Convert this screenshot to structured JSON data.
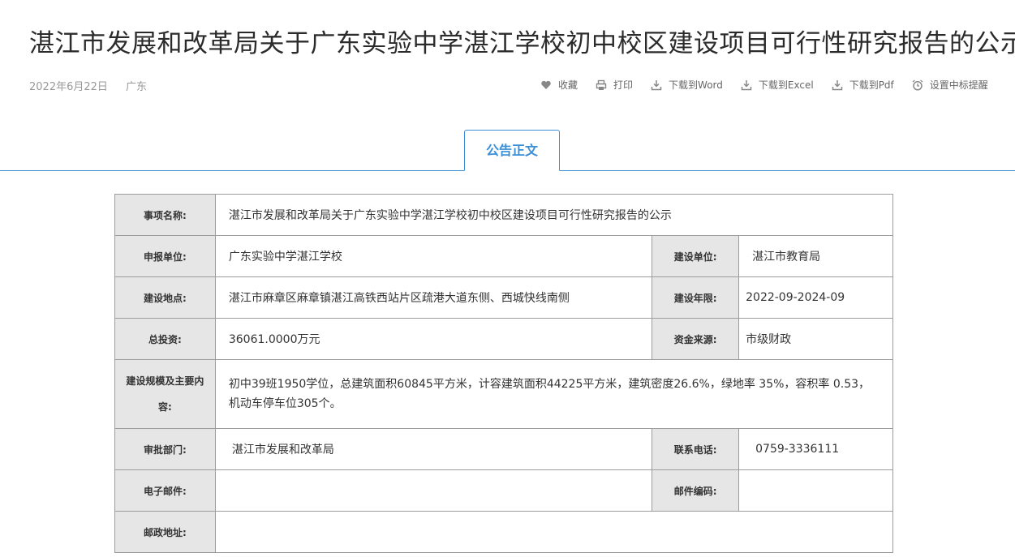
{
  "header": {
    "title": "湛江市发展和改革局关于广东实验中学湛江学校初中校区建设项目可行性研究报告的公示",
    "date": "2022年6月22日",
    "region": "广东"
  },
  "actions": [
    {
      "label": "收藏",
      "icon": "heart-icon"
    },
    {
      "label": "打印",
      "icon": "printer-icon"
    },
    {
      "label": "下载到Word",
      "icon": "download-icon"
    },
    {
      "label": "下载到Excel",
      "icon": "download-icon"
    },
    {
      "label": "下载到Pdf",
      "icon": "download-icon"
    },
    {
      "label": "设置中标提醒",
      "icon": "alarm-clock-icon"
    }
  ],
  "tab": {
    "label": "公告正文"
  },
  "table": {
    "item_name_label": "事项名称:",
    "item_name": "湛江市发展和改革局关于广东实验中学湛江学校初中校区建设项目可行性研究报告的公示",
    "applicant_label": "申报单位:",
    "applicant": "广东实验中学湛江学校",
    "builder_label": "建设单位:",
    "builder": "湛江市教育局",
    "location_label": "建设地点:",
    "location": "湛江市麻章区麻章镇湛江高铁西站片区疏港大道东侧、西城快线南侧",
    "period_label": "建设年限:",
    "period": "2022-09-2024-09",
    "investment_label": "总投资:",
    "investment": "36061.0000万元",
    "funding_label": "资金来源:",
    "funding": "市级财政",
    "scale_label": "建设规模及主要内容:",
    "scale_line1": "初中39班1950学位，总建筑面积60845平方米，计容建筑面积44225平方米，建筑密度26.6%，绿地率 35%，容积率 0.53，",
    "scale_line2": "机动车停车位305个。",
    "approver_label": "审批部门:",
    "approver": "湛江市发展和改革局",
    "phone_label": "联系电话:",
    "phone": "0759-3336111",
    "email_label": "电子邮件:",
    "email": "",
    "postcode_label": "邮件编码:",
    "postcode": "",
    "address_label": "邮政地址:",
    "address": ""
  }
}
